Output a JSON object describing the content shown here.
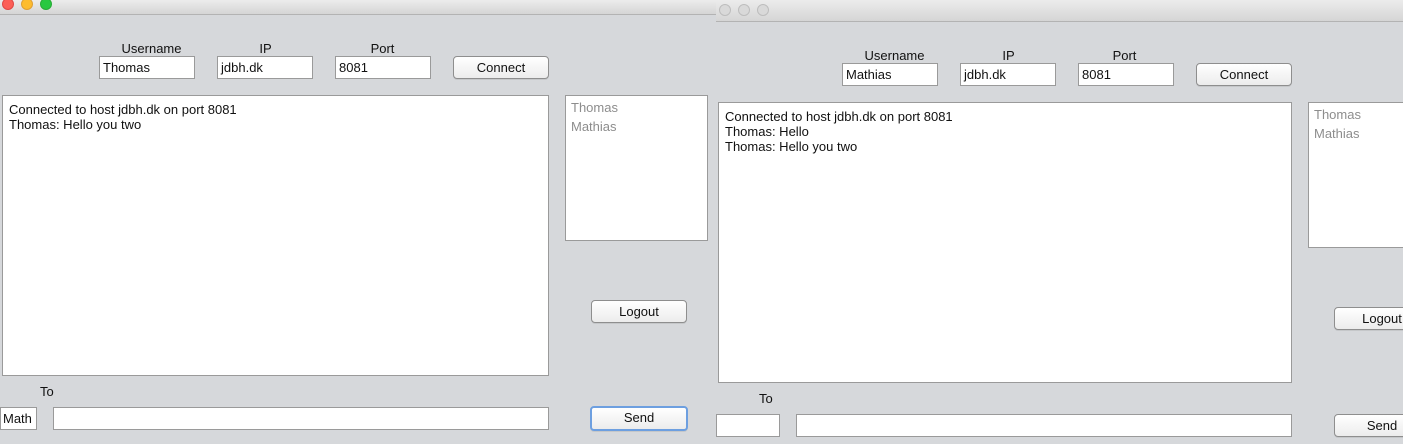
{
  "window1": {
    "connection": {
      "username_label": "Username",
      "ip_label": "IP",
      "port_label": "Port",
      "username_value": "Thomas",
      "ip_value": "jdbh.dk",
      "port_value": "8081",
      "connect_label": "Connect"
    },
    "chat": {
      "lines": [
        "Connected to host jdbh.dk on port 8081",
        "Thomas: Hello you two"
      ]
    },
    "users": [
      "Thomas",
      "Mathias"
    ],
    "logout_label": "Logout",
    "to_label": "To",
    "to_value": "Math",
    "message_value": "",
    "send_label": "Send"
  },
  "window2": {
    "connection": {
      "username_label": "Username",
      "ip_label": "IP",
      "port_label": "Port",
      "username_value": "Mathias",
      "ip_value": "jdbh.dk",
      "port_value": "8081",
      "connect_label": "Connect"
    },
    "chat": {
      "lines": [
        "Connected to host jdbh.dk on port 8081",
        "Thomas: Hello",
        "Thomas: Hello you two"
      ]
    },
    "users": [
      "Thomas",
      "Mathias"
    ],
    "logout_label": "Logout",
    "to_label": "To",
    "to_value": "",
    "message_value": "",
    "send_label": "Send"
  }
}
